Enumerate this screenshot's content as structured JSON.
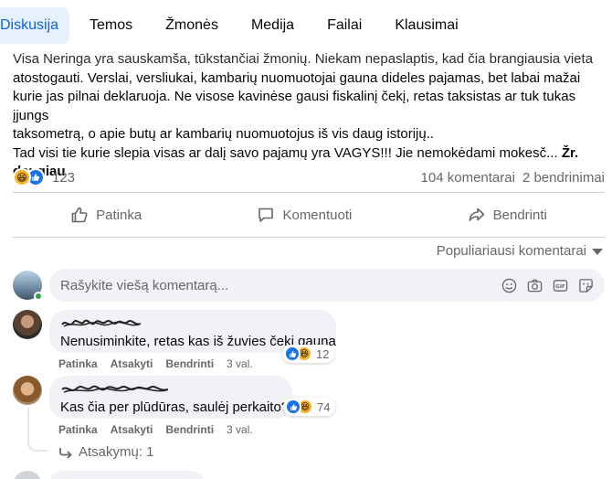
{
  "tabs": [
    {
      "label": "Diskusija",
      "active": true
    },
    {
      "label": "Temos",
      "active": false
    },
    {
      "label": "Žmonės",
      "active": false
    },
    {
      "label": "Medija",
      "active": false
    },
    {
      "label": "Failai",
      "active": false
    },
    {
      "label": "Klausimai",
      "active": false
    }
  ],
  "post": {
    "lines": [
      "Visa Neringa yra sauskamša, tūkstančiai žmonių. Niekam nepaslaptis, kad čia brangiausia vieta",
      "atostogauti. Verslai, versliukai, kambarių nuomuotojai gauna dideles pajamas, bet labai mažai",
      "kurie jas pilnai deklaruoja. Ne visose kavinėse gausi fiskalinį čekį, retas taksistas ar tuk tukas įjungs",
      "taksometrą, o apie butų ar kambarių nuomuotojus iš vis daug istorijų..",
      "Tad visi tie  kurie slepia visas ar dalį savo pajamų yra VAGYS!!! Jie nemokėdami mokesč... "
    ],
    "see_more": "Žr. daugiau",
    "reaction_count": "123",
    "comments_count": "104 komentarai",
    "shares_count": "2 bendrinimai"
  },
  "actions": {
    "like": "Patinka",
    "comment": "Komentuoti",
    "share": "Bendrinti"
  },
  "sort_label": "Populiariausi komentarai",
  "composer": {
    "placeholder": "Rašykite viešą komentarą..."
  },
  "comments": [
    {
      "text": "Nenusiminkite, retas kas iš žuvies čekį gauna",
      "reaction_count": "12",
      "meta": {
        "like": "Patinka",
        "reply": "Atsakyti",
        "share": "Bendrinti",
        "time": "3 val."
      }
    },
    {
      "text": "Kas čia per plūdūras, saulėj perkaito?",
      "reaction_count": "74",
      "meta": {
        "like": "Patinka",
        "reply": "Atsakyti",
        "share": "Bendrinti",
        "time": "3 val."
      }
    }
  ],
  "replies_label": "Atsakymų: 1",
  "colors": {
    "accent": "#0a66e0",
    "like_blue": "#1b74e4",
    "haha_yellow": "#f7b125",
    "secondary_text": "#65676b",
    "bubble_bg": "#f0f2f5"
  },
  "icons": [
    "haha-reaction-icon",
    "like-reaction-icon",
    "thumbs-up-icon",
    "comment-icon",
    "share-icon",
    "chevron-down-icon",
    "emoji-icon",
    "camera-icon",
    "gif-icon",
    "sticker-icon",
    "reply-arrow-icon"
  ]
}
